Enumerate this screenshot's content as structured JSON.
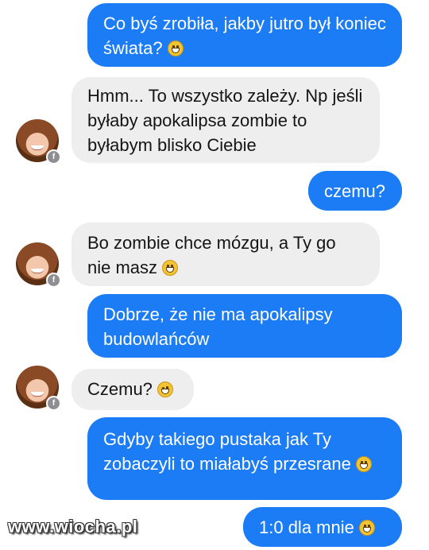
{
  "messages": [
    {
      "side": "out",
      "text": "Co byś zrobiła, jakby jutro był koniec świata?",
      "emoji": "smile"
    },
    {
      "side": "in",
      "text": "Hmm... To wszystko zależy. Np jeśli byłaby apokalipsa zombie to byłabym blisko Ciebie",
      "emoji": null
    },
    {
      "side": "out",
      "text": "czemu?",
      "emoji": null
    },
    {
      "side": "in",
      "text": "Bo zombie chce mózgu, a Ty go nie masz",
      "emoji": "smile"
    },
    {
      "side": "out",
      "text": "Dobrze, że nie ma apokalipsy budowlańców",
      "emoji": null
    },
    {
      "side": "in",
      "text": "Czemu?",
      "emoji": "wink"
    },
    {
      "side": "out",
      "text": "Gdyby takiego pustaka jak Ty zobaczyli to miałabyś przesrane",
      "emoji": "smile"
    },
    {
      "side": "out",
      "text": "1:0 dla mnie",
      "emoji": "smile"
    }
  ],
  "watermark": "www.wiocha.pl",
  "colors": {
    "outgoing": "#1b7cf5",
    "incoming": "#eeeeef"
  }
}
